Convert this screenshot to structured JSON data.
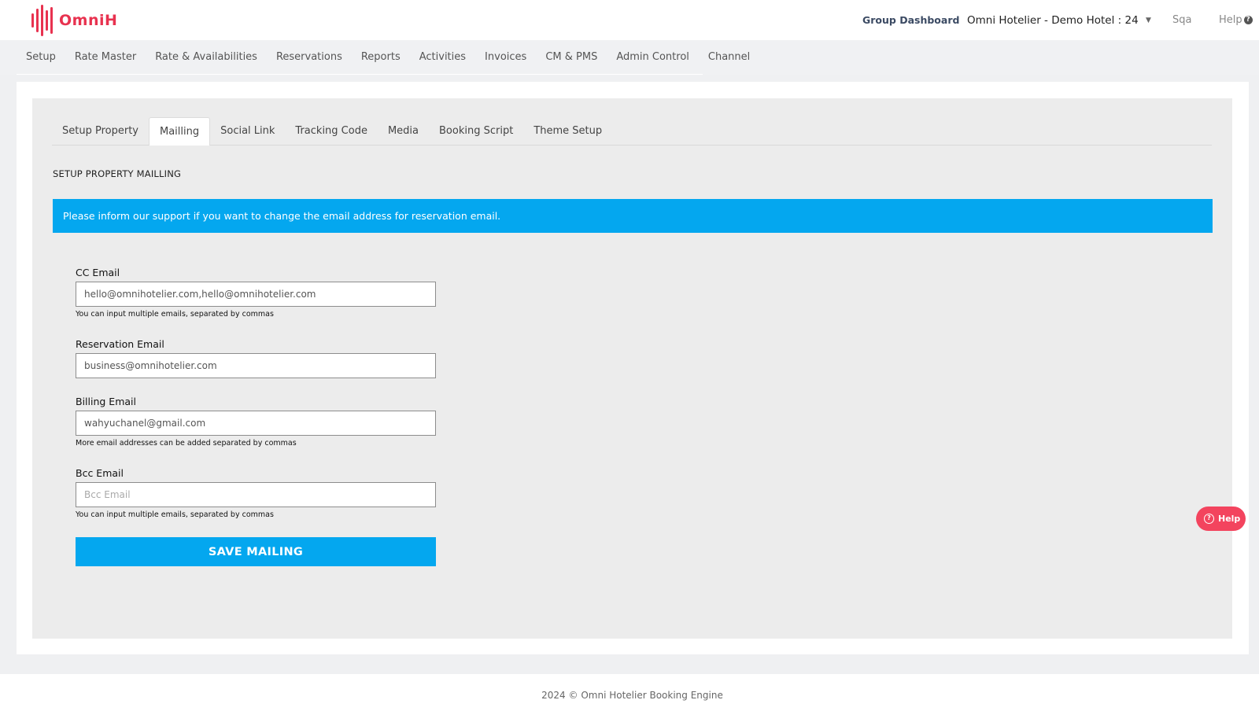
{
  "brand": {
    "name": "OmniH",
    "color": "#e8324f"
  },
  "header": {
    "group_dashboard": "Group Dashboard",
    "hotel_selector": "Omni Hotelier - Demo Hotel : 24",
    "user": "Sqa",
    "help": "Help"
  },
  "menu": {
    "items": [
      {
        "label": "Setup"
      },
      {
        "label": "Rate Master"
      },
      {
        "label": "Rate & Availabilities"
      },
      {
        "label": "Reservations"
      },
      {
        "label": "Reports"
      },
      {
        "label": "Activities"
      },
      {
        "label": "Invoices"
      },
      {
        "label": "CM & PMS"
      },
      {
        "label": "Admin Control"
      },
      {
        "label": "Channel"
      }
    ]
  },
  "tabs": {
    "items": [
      {
        "label": "Setup Property"
      },
      {
        "label": "Mailling",
        "active": true
      },
      {
        "label": "Social Link"
      },
      {
        "label": "Tracking Code"
      },
      {
        "label": "Media"
      },
      {
        "label": "Booking Script"
      },
      {
        "label": "Theme Setup"
      }
    ]
  },
  "section_title": "SETUP PROPERTY MAILLING",
  "alert": {
    "text": "Please inform our support if you want to change the email address for reservation email.",
    "color": "#04a7ef"
  },
  "form": {
    "cc_email": {
      "label": "CC Email",
      "value": "hello@omnihotelier.com,hello@omnihotelier.com",
      "hint": "You can input multiple emails, separated by commas"
    },
    "reservation_email": {
      "label": "Reservation Email",
      "value": "business@omnihotelier.com"
    },
    "billing_email": {
      "label": "Billing Email",
      "value": "wahyuchanel@gmail.com",
      "hint": "More email addresses can be added separated by commas"
    },
    "bcc_email": {
      "label": "Bcc Email",
      "value": "",
      "placeholder": "Bcc Email",
      "hint": "You can input multiple emails, separated by commas"
    },
    "save_label": "SAVE MAILING"
  },
  "floating_help": {
    "label": "Help",
    "color": "#f3445e"
  },
  "footer": {
    "text": "2024 © Omni Hotelier Booking Engine"
  }
}
